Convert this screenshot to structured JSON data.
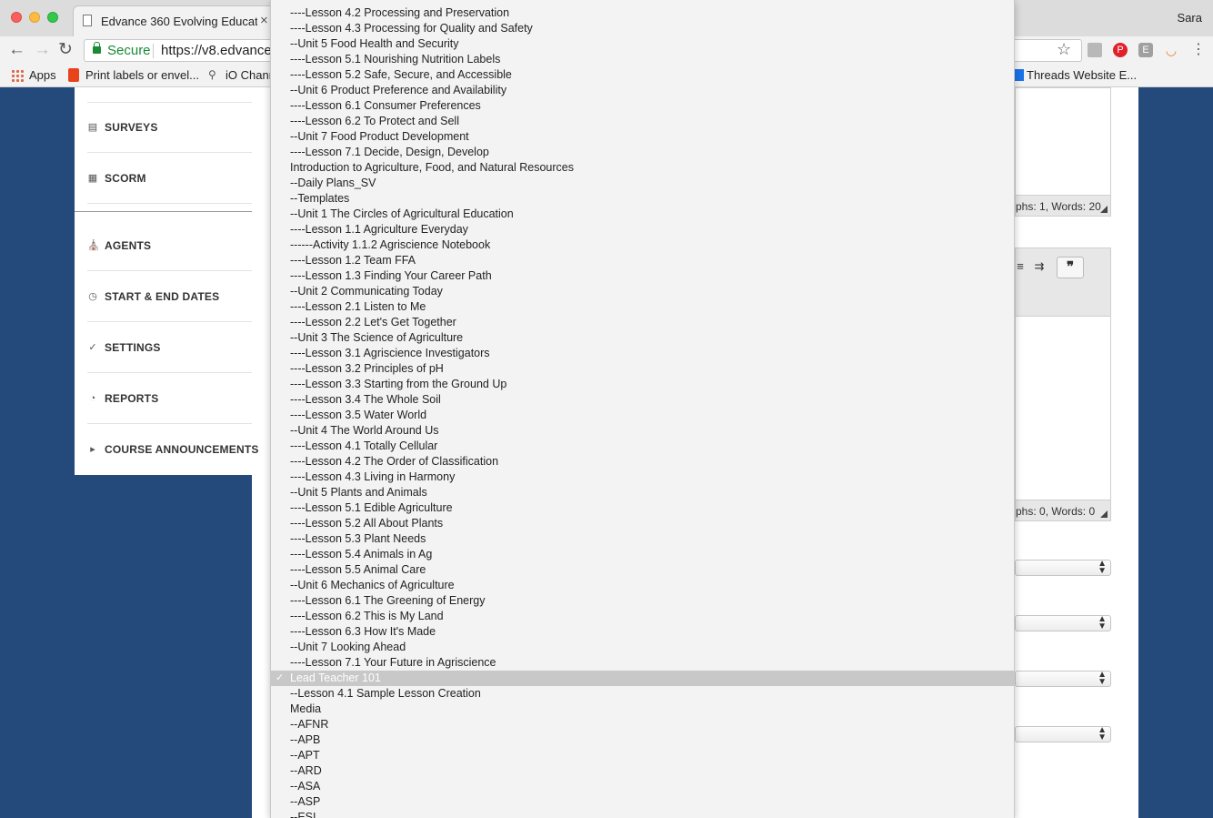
{
  "browser": {
    "tab_title": "Edvance 360 Evolving Educati",
    "tab_close": "×",
    "user": "Sara",
    "secure_label": "Secure",
    "url": "https://v8.edvance",
    "bookmarks": [
      {
        "label": "Apps"
      },
      {
        "label": "Print labels or envel..."
      },
      {
        "label": "iO Chann"
      },
      {
        "label": "Threads Website E..."
      }
    ]
  },
  "sidebar": {
    "items": [
      {
        "label": "SURVEYS",
        "icon": "survey-icon"
      },
      {
        "label": "SCORM",
        "icon": "scorm-icon"
      },
      {
        "label": "AGENTS",
        "icon": "pin-icon"
      },
      {
        "label": "START & END DATES",
        "icon": "clock-icon"
      },
      {
        "label": "SETTINGS",
        "icon": "wrench-icon"
      },
      {
        "label": "REPORTS",
        "icon": "pie-chart-icon"
      },
      {
        "label": "COURSE ANNOUNCEMENTS",
        "icon": "megaphone-icon"
      }
    ]
  },
  "editor": {
    "status_1": "phs: 1, Words: 20",
    "status_2": "phs: 0, Words: 0",
    "quote_button": "❞"
  },
  "dropdown": {
    "options": [
      "----Lesson 4.2 Processing and Preservation",
      "----Lesson 4.3 Processing for Quality and Safety",
      "--Unit 5 Food Health and Security",
      "----Lesson 5.1 Nourishing Nutrition Labels",
      "----Lesson 5.2 Safe, Secure, and Accessible",
      "--Unit 6 Product Preference and Availability",
      "----Lesson 6.1 Consumer Preferences",
      "----Lesson 6.2 To Protect and Sell",
      "--Unit 7 Food Product Development",
      "----Lesson 7.1 Decide, Design, Develop",
      "Introduction to Agriculture, Food, and Natural Resources",
      "--Daily Plans_SV",
      "--Templates",
      "--Unit 1 The Circles of Agricultural Education",
      "----Lesson 1.1 Agriculture Everyday",
      "------Activity 1.1.2 Agriscience Notebook",
      "----Lesson 1.2 Team FFA",
      "----Lesson 1.3 Finding Your Career Path",
      "--Unit 2 Communicating Today",
      "----Lesson 2.1 Listen to Me",
      "----Lesson 2.2 Let's Get Together",
      "--Unit 3 The Science of Agriculture",
      "----Lesson 3.1 Agriscience Investigators",
      "----Lesson 3.2 Principles of pH",
      "----Lesson 3.3 Starting from the Ground Up",
      "----Lesson 3.4 The Whole Soil",
      "----Lesson 3.5 Water World",
      "--Unit 4 The World Around Us",
      "----Lesson 4.1 Totally Cellular",
      "----Lesson 4.2 The Order of Classification",
      "----Lesson 4.3 Living in Harmony",
      "--Unit 5 Plants and Animals",
      "----Lesson 5.1 Edible Agriculture",
      "----Lesson 5.2 All About Plants",
      "----Lesson 5.3 Plant Needs",
      "----Lesson 5.4 Animals in Ag",
      "----Lesson 5.5 Animal Care",
      "--Unit 6 Mechanics of Agriculture",
      "----Lesson 6.1 The Greening of Energy",
      "----Lesson 6.2 This is My Land",
      "----Lesson 6.3 How It's Made",
      "--Unit 7 Looking Ahead",
      "----Lesson 7.1 Your Future in Agriscience",
      "Lead Teacher 101",
      "--Lesson 4.1 Sample Lesson Creation",
      "Media",
      "--AFNR",
      "--APB",
      "--APT",
      "--ARD",
      "--ASA",
      "--ASP",
      "--ESI"
    ],
    "selected_index": 43,
    "check_mark": "✓"
  }
}
